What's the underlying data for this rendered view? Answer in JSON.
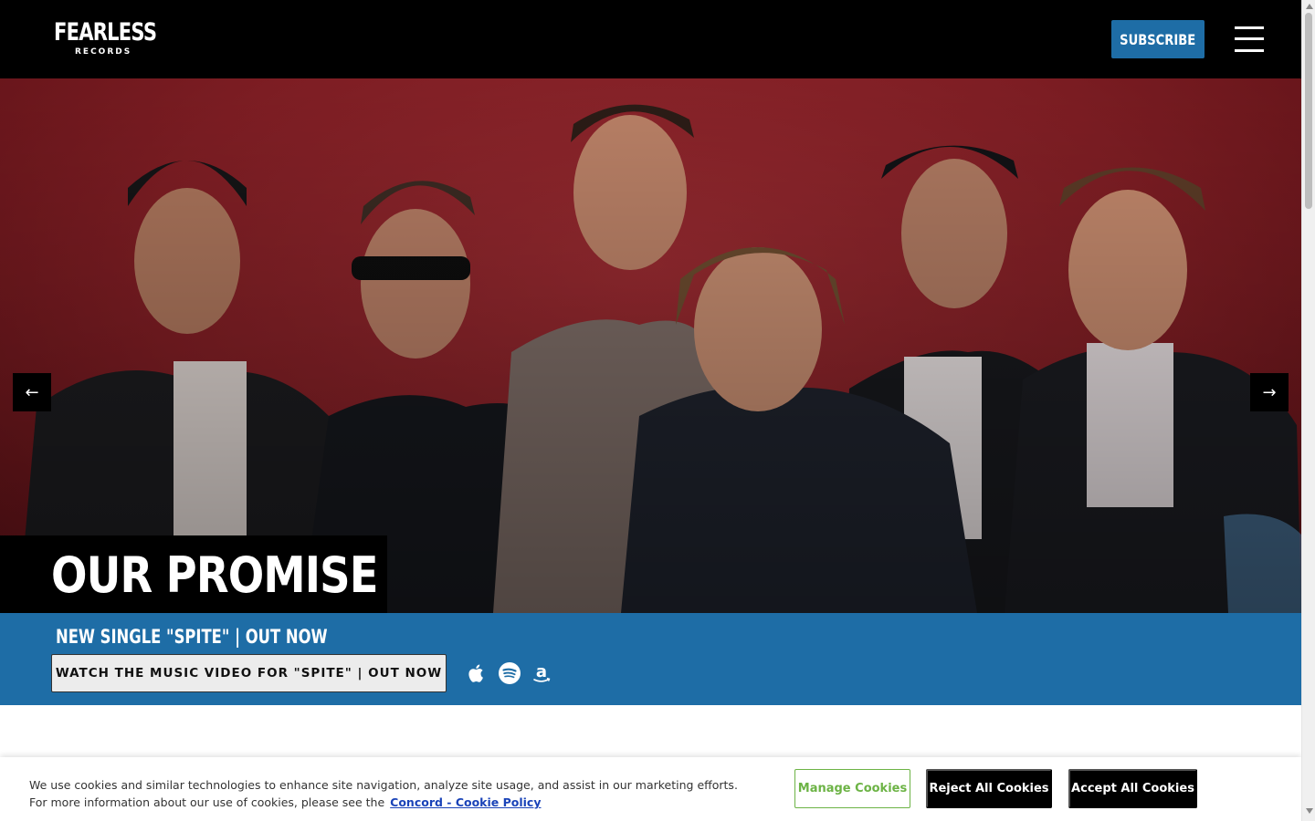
{
  "brand": {
    "name": "FEARLESS",
    "sub": "RECORDS"
  },
  "header": {
    "subscribe_label": "SUBSCRIBE",
    "menu_icon": "hamburger-menu-icon"
  },
  "hero": {
    "title": "OUR PROMISE",
    "prev_arrow": "←",
    "next_arrow": "→",
    "background_color": "#8a2228"
  },
  "band": {
    "title": "NEW SINGLE \"SPITE\" | OUT NOW",
    "button_label": "WATCH THE MUSIC VIDEO FOR \"SPITE\" | OUT NOW",
    "streaming_icons": [
      "apple-music-icon",
      "spotify-icon",
      "amazon-music-icon"
    ],
    "color": "#1e6da6"
  },
  "cookie": {
    "line1": "We use cookies and similar technologies to enhance site navigation, analyze site usage, and assist in our marketing efforts.",
    "line2": "For more information about our use of cookies, please see the",
    "link": "Concord - Cookie Policy",
    "manage_label": "Manage Cookies",
    "reject_label": "Reject All Cookies",
    "accept_label": "Accept All Cookies",
    "manage_color": "#6cb345"
  }
}
